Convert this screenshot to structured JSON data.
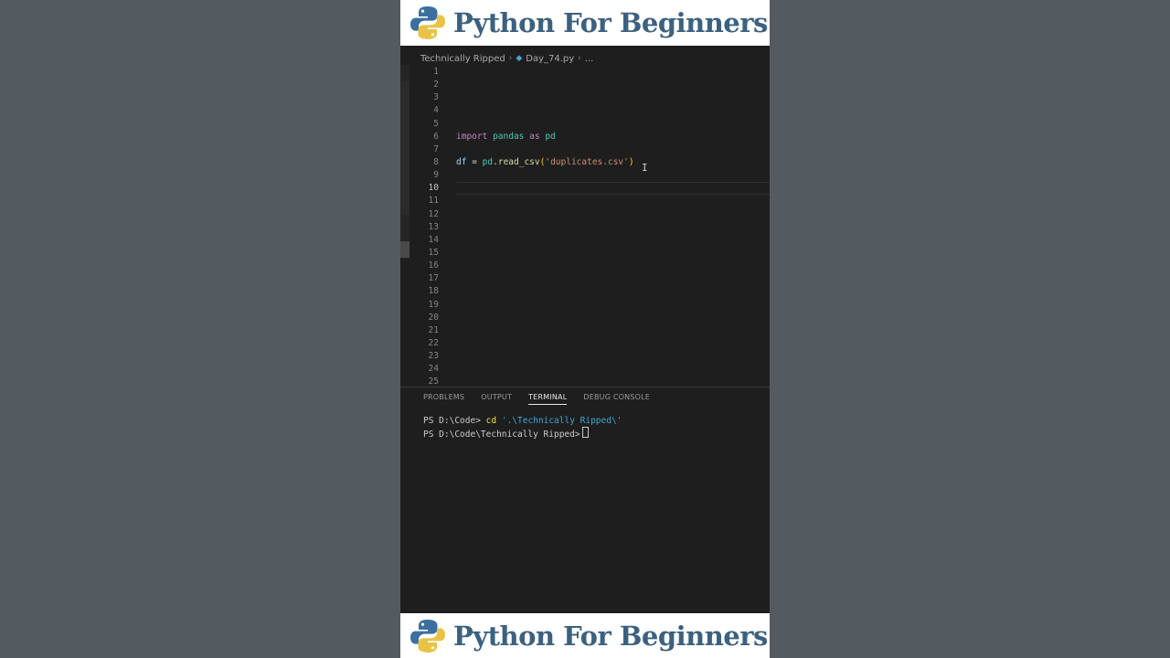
{
  "banner": {
    "title": "Python For Beginners",
    "title_color": "#3c6180"
  },
  "editor": {
    "breadcrumb": {
      "folder": "Technically Ripped",
      "file": "Day_74.py",
      "ellipsis": "..."
    },
    "line_numbers": [
      "1",
      "2",
      "3",
      "4",
      "5",
      "6",
      "7",
      "8",
      "9",
      "10",
      "11",
      "12",
      "13",
      "14",
      "15",
      "16",
      "17",
      "18",
      "19",
      "20",
      "21",
      "22",
      "23",
      "24",
      "25"
    ],
    "active_line": "10",
    "code": {
      "line6": {
        "kw_import": "import",
        "module": "pandas",
        "kw_as": "as",
        "alias": "pd"
      },
      "line8": {
        "var": "df",
        "op": "=",
        "obj": "pd",
        "dot": ".",
        "fn": "read_csv",
        "open": "(",
        "arg": "'duplicates.csv'",
        "close": ")"
      }
    },
    "cursor_glyph": "I"
  },
  "panel": {
    "tabs": [
      {
        "label": "PROBLEMS"
      },
      {
        "label": "OUTPUT"
      },
      {
        "label": "TERMINAL"
      },
      {
        "label": "DEBUG CONSOLE"
      }
    ],
    "active_tab": "TERMINAL",
    "terminal": {
      "line1": {
        "prompt": "PS D:\\Code>",
        "cmd": "cd",
        "arg": "'.\\Technically Ripped\\'"
      },
      "line2": {
        "prompt": "PS D:\\Code\\Technically Ripped>"
      }
    }
  },
  "colors": {
    "background": "#535a60",
    "editor_bg": "#1e1e1e",
    "keyword": "#c586c0",
    "module": "#4ec9b0",
    "string": "#ce9178",
    "function": "#dcdcaa"
  }
}
